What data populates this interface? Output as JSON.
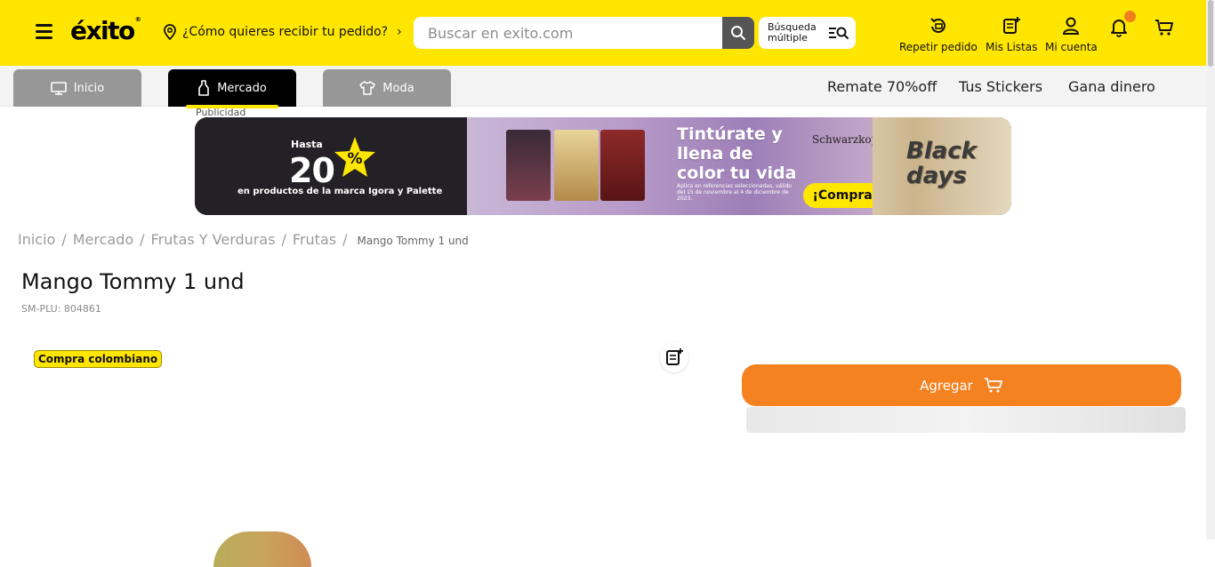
{
  "header": {
    "logo_text": "éxito",
    "logo_reg": "®",
    "location_prompt": "¿Cómo quieres recibir tu pedido?",
    "search_placeholder": "Buscar en exito.com",
    "multi_search_label": "Búsqueda múltiple",
    "actions": [
      {
        "label": "Repetir pedido",
        "icon": "repeat-order-icon"
      },
      {
        "label": "Mis Listas",
        "icon": "list-add-icon"
      },
      {
        "label": "Mi cuenta",
        "icon": "user-icon"
      },
      {
        "label": "",
        "icon": "bell-icon"
      },
      {
        "label": "",
        "icon": "cart-icon"
      }
    ],
    "brand_yellow": "#ffe600",
    "notification_color": "#f27f1e"
  },
  "tabs": [
    {
      "label": "Inicio",
      "icon": "monitor-icon",
      "active": false
    },
    {
      "label": "Mercado",
      "icon": "bottle-icon",
      "active": true
    },
    {
      "label": "Moda",
      "icon": "shirt-icon",
      "active": false
    }
  ],
  "nav_links": [
    "Remate 70%off",
    "Tus Stickers",
    "Gana dinero"
  ],
  "banner": {
    "ad_label": "Publicidad",
    "hasta": "Hasta",
    "percent": "20",
    "percent_sign": "%",
    "subtitle": "en productos de la marca Igora y Palette",
    "headline": "Tintúrate y llena de color tu vida",
    "fine_print": "Aplica en referencias seleccionadas, válido del 15 de noviembre al 4 de diciembre de 2023.",
    "brand": "Schwarzkopf",
    "cta": "¡Compra ya!",
    "event": "Black days"
  },
  "breadcrumb": {
    "items": [
      "Inicio",
      "Mercado",
      "Frutas Y Verduras",
      "Frutas"
    ],
    "current": "Mango Tommy 1 und",
    "separator": "/"
  },
  "product": {
    "title": "Mango Tommy 1 und",
    "sku": "SM-PLU: 804861",
    "badge": "Compra colombiano",
    "add_label": "Agregar",
    "add_color": "#f58220"
  }
}
